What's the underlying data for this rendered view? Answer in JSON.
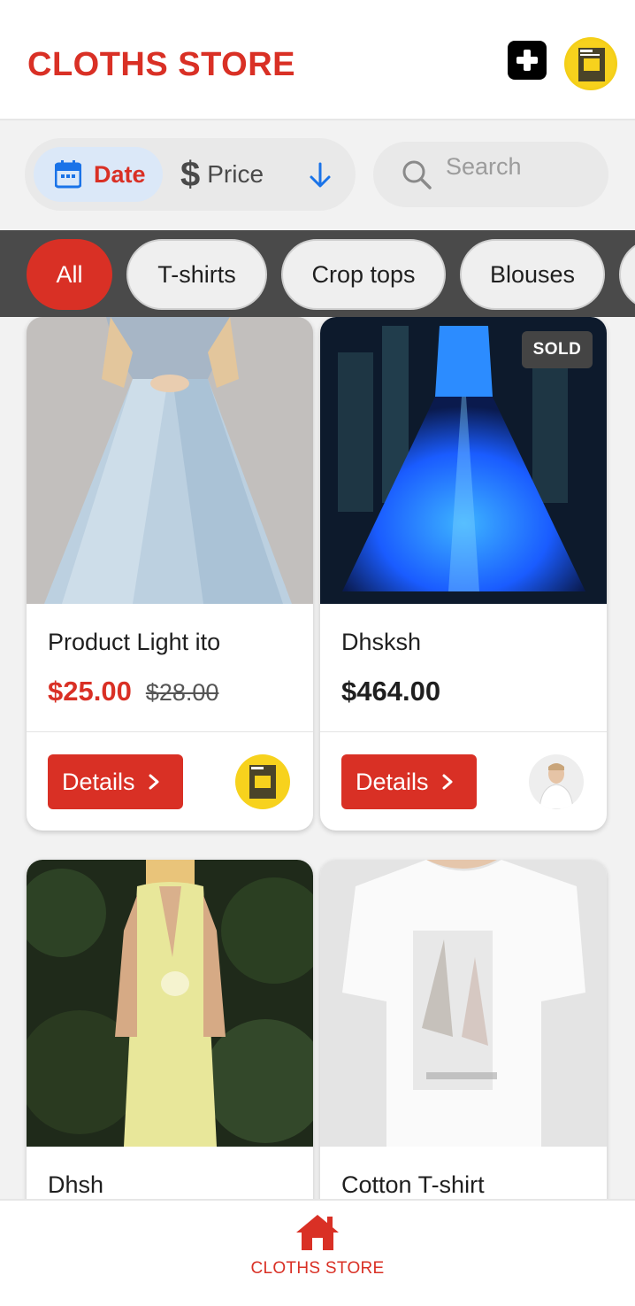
{
  "header": {
    "title": "CLOTHS STORE",
    "add_icon": "plus-square-icon",
    "avatar": "user-avatar"
  },
  "sort": {
    "date_label": "Date",
    "price_label": "Price",
    "date_icon": "calendar-icon",
    "price_icon": "dollar-icon",
    "direction_icon": "arrow-down-icon",
    "active": "Date"
  },
  "search": {
    "placeholder": "Search",
    "icon": "search-icon"
  },
  "categories": [
    {
      "label": "All",
      "active": true
    },
    {
      "label": "T-shirts",
      "active": false
    },
    {
      "label": "Crop tops",
      "active": false
    },
    {
      "label": "Blouses",
      "active": false
    }
  ],
  "products": [
    {
      "title": "Product Light ito",
      "price": "$25.00",
      "old_price": "$28.00",
      "button": "Details",
      "sold": false
    },
    {
      "title": "Dhsksh",
      "price": "$464.00",
      "button": "Details",
      "sold": true,
      "sold_label": "SOLD"
    },
    {
      "title": "Dhsh"
    },
    {
      "title": "Cotton T-shirt"
    }
  ],
  "bottom_nav": {
    "home_label": "CLOTHS STORE",
    "home_icon": "home-icon"
  },
  "colors": {
    "accent": "#d93025",
    "dark_bar": "#4a4a4a",
    "background": "#f2f2f2"
  }
}
